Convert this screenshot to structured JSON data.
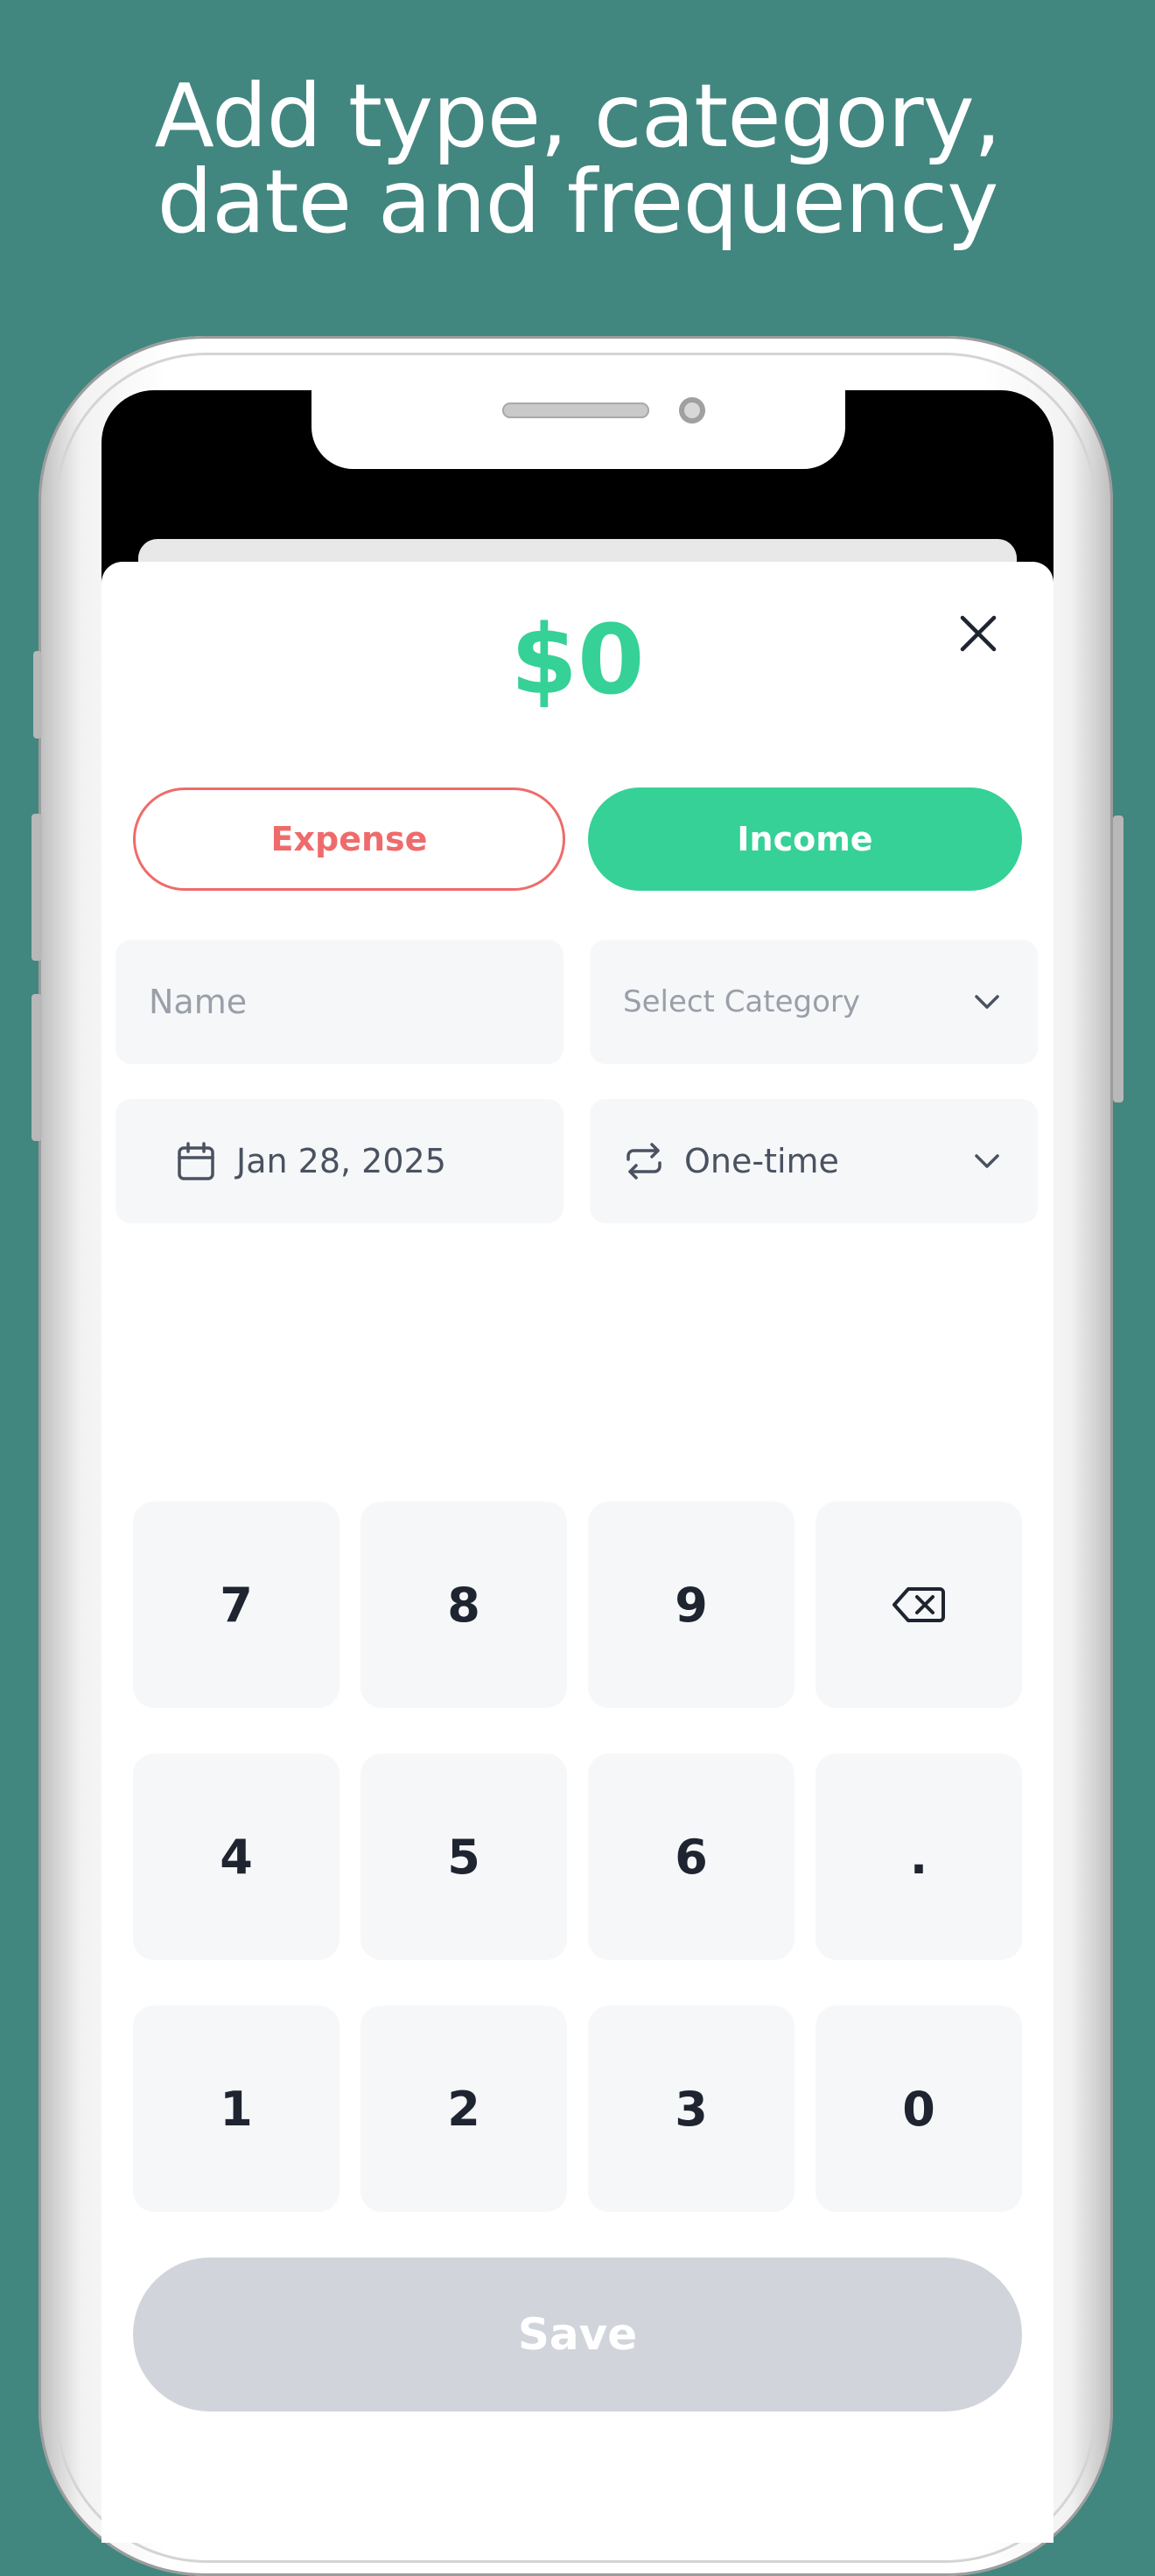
{
  "headline": {
    "line1": "Add type, category,",
    "line2": "date and  frequency"
  },
  "amount": "$0",
  "type_toggle": {
    "expense_label": "Expense",
    "income_label": "Income",
    "selected": "Income"
  },
  "form": {
    "name_placeholder": "Name",
    "category_placeholder": "Select Category",
    "date_value": "Jan 28, 2025",
    "frequency_value": "One-time"
  },
  "keypad": {
    "row1": [
      "7",
      "8",
      "9",
      "backspace"
    ],
    "row2": [
      "4",
      "5",
      "6",
      "."
    ],
    "row3": [
      "1",
      "2",
      "3",
      "0"
    ]
  },
  "save_label": "Save",
  "icons": [
    "close-icon",
    "chevron-down-icon",
    "calendar-icon",
    "repeat-icon",
    "backspace-icon"
  ],
  "colors": {
    "background": "#428680",
    "accent_green": "#35d197",
    "expense_red": "#ef6b6b",
    "field_bg": "#f6f7f9",
    "save_disabled": "#d1d4db"
  }
}
